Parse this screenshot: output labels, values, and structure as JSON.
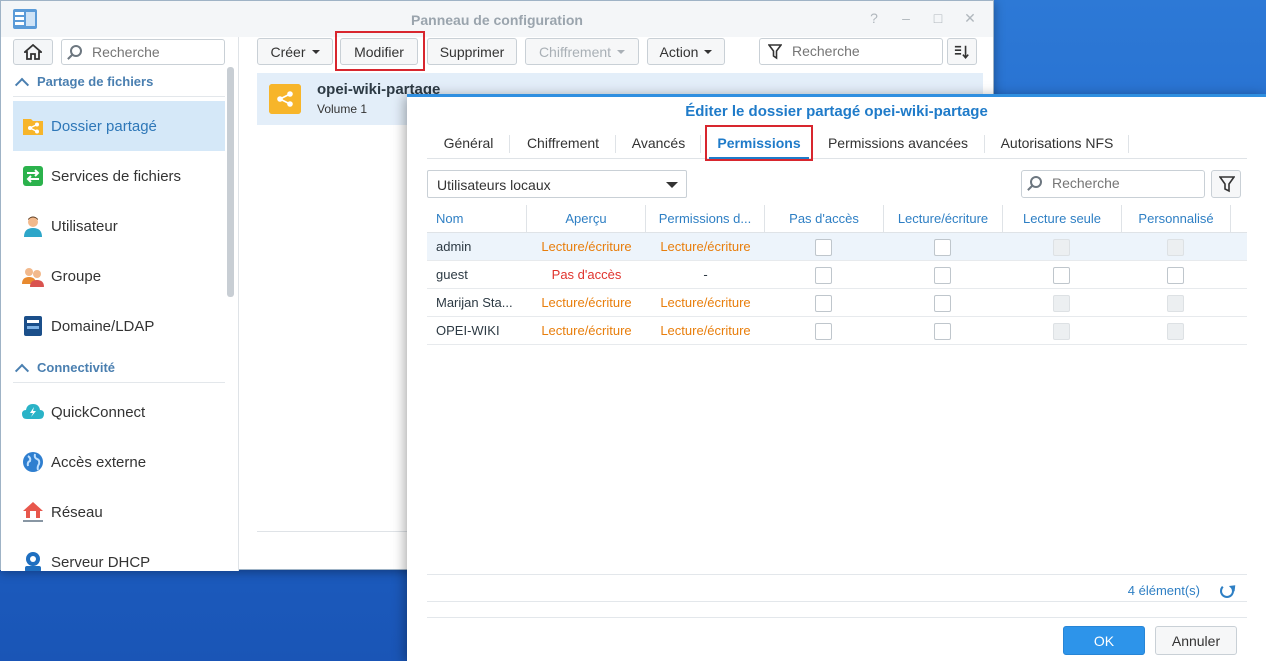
{
  "control_panel": {
    "title": "Panneau de configuration",
    "window_buttons": [
      "?",
      "–",
      "□",
      "✕"
    ],
    "sidebar": {
      "search_placeholder": "Recherche",
      "sections": [
        {
          "label": "Partage de fichiers"
        },
        {
          "label": "Connectivité"
        }
      ],
      "items": [
        {
          "label": "Dossier partagé",
          "icon": "shared-folder-icon",
          "active": true
        },
        {
          "label": "Services de fichiers",
          "icon": "file-services-icon"
        },
        {
          "label": "Utilisateur",
          "icon": "user-icon"
        },
        {
          "label": "Groupe",
          "icon": "group-icon"
        },
        {
          "label": "Domaine/LDAP",
          "icon": "domain-ldap-icon"
        },
        {
          "label": "QuickConnect",
          "icon": "quickconnect-icon"
        },
        {
          "label": "Accès externe",
          "icon": "external-access-icon"
        },
        {
          "label": "Réseau",
          "icon": "network-icon"
        },
        {
          "label": "Serveur DHCP",
          "icon": "dhcp-server-icon"
        }
      ]
    },
    "toolbar": {
      "create": "Créer",
      "modify": "Modifier",
      "delete": "Supprimer",
      "encryption": "Chiffrement",
      "action": "Action",
      "search_placeholder": "Recherche"
    },
    "shares": [
      {
        "name": "opei-wiki-partage",
        "volume": "Volume 1"
      }
    ]
  },
  "dialog": {
    "title": "Éditer le dossier partagé opei-wiki-partage",
    "tabs": [
      "Général",
      "Chiffrement",
      "Avancés",
      "Permissions",
      "Permissions avancées",
      "Autorisations NFS"
    ],
    "active_tab": "Permissions",
    "user_scope": "Utilisateurs locaux",
    "search_placeholder": "Recherche",
    "columns": [
      "Nom",
      "Aperçu",
      "Permissions d...",
      "Pas d'accès",
      "Lecture/écriture",
      "Lecture seule",
      "Personnalisé"
    ],
    "rows": [
      {
        "name": "admin",
        "preview": "Lecture/écriture",
        "perm_group": "Lecture/écriture"
      },
      {
        "name": "guest",
        "preview": "Pas d'accès",
        "perm_group": "-"
      },
      {
        "name": "Marijan Sta...",
        "preview": "Lecture/écriture",
        "perm_group": "Lecture/écriture"
      },
      {
        "name": "OPEI-WIKI",
        "preview": "Lecture/écriture",
        "perm_group": "Lecture/écriture"
      }
    ],
    "count": "4 élément(s)",
    "ok": "OK",
    "cancel": "Annuler"
  },
  "colors": {
    "accent": "#1f7bc9",
    "highlight": "#d8262e",
    "orange_text": "#e87e0c",
    "red_text": "#e0342e"
  }
}
